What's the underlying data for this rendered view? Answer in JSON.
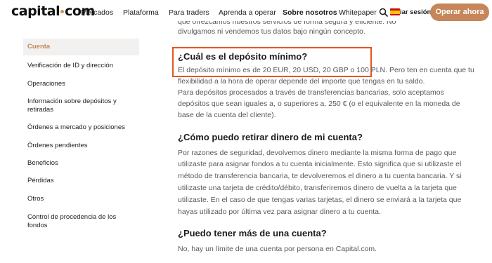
{
  "header": {
    "logo_text": "capital",
    "logo_suffix": "com",
    "nav": [
      "Mercados",
      "Plataforma",
      "Para traders",
      "Aprenda a operar",
      "Sobre nosotros",
      "Whitepaper"
    ],
    "login_label": "iar sesión",
    "cta_label": "Operar ahora",
    "flag_icon": "spain-flag-icon",
    "search_icon": "search-icon"
  },
  "sidebar": {
    "items": [
      "Cuenta",
      "Verificación de ID y dirección",
      "Operaciones",
      "Información sobre depósitos y",
      "retiradas",
      "Órdenes a mercado y posiciones",
      "Órdenes pendientes",
      "Beneficios",
      "Pérdidas",
      "Otros",
      "Control de procedencia de los",
      "fondos"
    ]
  },
  "main": {
    "intro": {
      "line1": "que ofrezcamos nuestros servicios de forma segura y eficiente. No",
      "line2": "divulgamos ni vendemos tus datos bajo ningún concepto."
    },
    "q1": {
      "title": "¿Cuál es el depósito mínimo?",
      "line1_highlight": "El depósito mínimo es de 20 EUR, 20 USD, 20 GBP o 100 PLN.",
      "line1_rest": " Pero ten en cuenta que tu",
      "line2": "flexibilidad a la hora de operar depende del importe que tengas en tu saldo.",
      "line3": "Para depósitos procesados a través de transferencias bancarias, solo aceptamos",
      "line4": "depósitos que sean iguales a, o superiores a, 250 € (o el equivalente en la moneda de",
      "line5": "base de la cuenta del cliente)."
    },
    "q2": {
      "title": "¿Cómo puedo retirar dinero de mi cuenta?",
      "line1": "Por razones de seguridad, devolvemos dinero mediante la misma forma de pago que",
      "line2": "utilizaste para asignar fondos a tu cuenta inicialmente. Esto significa que si utilizaste el",
      "line3": "método de transferencia bancaria, te devolveremos el dinero a tu cuenta bancaria. Y si",
      "line4": "utilizaste una tarjeta de crédito/débito, transferiremos dinero de vuelta a la tarjeta que",
      "line5": "utilizaste. En el caso de que tengas varias tarjetas, el dinero se enviará a la tarjeta que",
      "line6": "hayas utilizado por última vez para asignar dinero a tu cuenta."
    },
    "q3": {
      "title": "¿Puedo tener más de una cuenta?",
      "line1": "No, hay un límite de una cuenta por persona en Capital.com."
    }
  },
  "colors": {
    "accent": "#c6865a",
    "highlight_border": "#e8541e",
    "text_body": "#5a5a5f"
  }
}
